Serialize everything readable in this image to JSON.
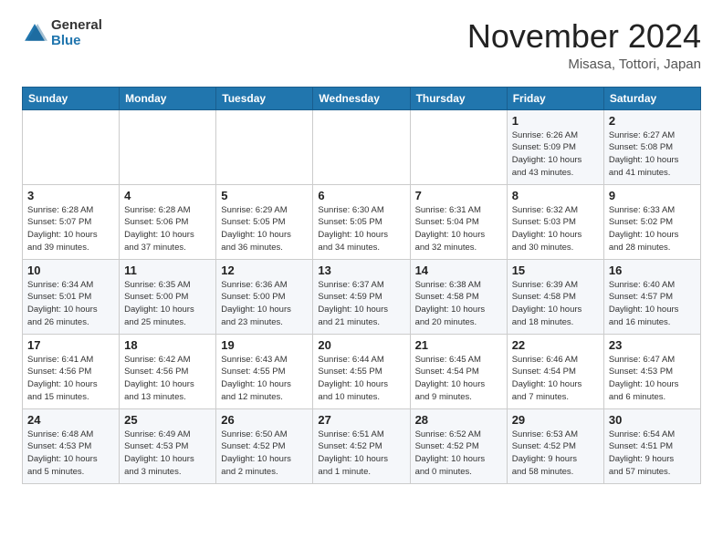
{
  "logo": {
    "general": "General",
    "blue": "Blue"
  },
  "title": "November 2024",
  "location": "Misasa, Tottori, Japan",
  "days_of_week": [
    "Sunday",
    "Monday",
    "Tuesday",
    "Wednesday",
    "Thursday",
    "Friday",
    "Saturday"
  ],
  "weeks": [
    [
      {
        "day": "",
        "detail": ""
      },
      {
        "day": "",
        "detail": ""
      },
      {
        "day": "",
        "detail": ""
      },
      {
        "day": "",
        "detail": ""
      },
      {
        "day": "",
        "detail": ""
      },
      {
        "day": "1",
        "detail": "Sunrise: 6:26 AM\nSunset: 5:09 PM\nDaylight: 10 hours\nand 43 minutes."
      },
      {
        "day": "2",
        "detail": "Sunrise: 6:27 AM\nSunset: 5:08 PM\nDaylight: 10 hours\nand 41 minutes."
      }
    ],
    [
      {
        "day": "3",
        "detail": "Sunrise: 6:28 AM\nSunset: 5:07 PM\nDaylight: 10 hours\nand 39 minutes."
      },
      {
        "day": "4",
        "detail": "Sunrise: 6:28 AM\nSunset: 5:06 PM\nDaylight: 10 hours\nand 37 minutes."
      },
      {
        "day": "5",
        "detail": "Sunrise: 6:29 AM\nSunset: 5:05 PM\nDaylight: 10 hours\nand 36 minutes."
      },
      {
        "day": "6",
        "detail": "Sunrise: 6:30 AM\nSunset: 5:05 PM\nDaylight: 10 hours\nand 34 minutes."
      },
      {
        "day": "7",
        "detail": "Sunrise: 6:31 AM\nSunset: 5:04 PM\nDaylight: 10 hours\nand 32 minutes."
      },
      {
        "day": "8",
        "detail": "Sunrise: 6:32 AM\nSunset: 5:03 PM\nDaylight: 10 hours\nand 30 minutes."
      },
      {
        "day": "9",
        "detail": "Sunrise: 6:33 AM\nSunset: 5:02 PM\nDaylight: 10 hours\nand 28 minutes."
      }
    ],
    [
      {
        "day": "10",
        "detail": "Sunrise: 6:34 AM\nSunset: 5:01 PM\nDaylight: 10 hours\nand 26 minutes."
      },
      {
        "day": "11",
        "detail": "Sunrise: 6:35 AM\nSunset: 5:00 PM\nDaylight: 10 hours\nand 25 minutes."
      },
      {
        "day": "12",
        "detail": "Sunrise: 6:36 AM\nSunset: 5:00 PM\nDaylight: 10 hours\nand 23 minutes."
      },
      {
        "day": "13",
        "detail": "Sunrise: 6:37 AM\nSunset: 4:59 PM\nDaylight: 10 hours\nand 21 minutes."
      },
      {
        "day": "14",
        "detail": "Sunrise: 6:38 AM\nSunset: 4:58 PM\nDaylight: 10 hours\nand 20 minutes."
      },
      {
        "day": "15",
        "detail": "Sunrise: 6:39 AM\nSunset: 4:58 PM\nDaylight: 10 hours\nand 18 minutes."
      },
      {
        "day": "16",
        "detail": "Sunrise: 6:40 AM\nSunset: 4:57 PM\nDaylight: 10 hours\nand 16 minutes."
      }
    ],
    [
      {
        "day": "17",
        "detail": "Sunrise: 6:41 AM\nSunset: 4:56 PM\nDaylight: 10 hours\nand 15 minutes."
      },
      {
        "day": "18",
        "detail": "Sunrise: 6:42 AM\nSunset: 4:56 PM\nDaylight: 10 hours\nand 13 minutes."
      },
      {
        "day": "19",
        "detail": "Sunrise: 6:43 AM\nSunset: 4:55 PM\nDaylight: 10 hours\nand 12 minutes."
      },
      {
        "day": "20",
        "detail": "Sunrise: 6:44 AM\nSunset: 4:55 PM\nDaylight: 10 hours\nand 10 minutes."
      },
      {
        "day": "21",
        "detail": "Sunrise: 6:45 AM\nSunset: 4:54 PM\nDaylight: 10 hours\nand 9 minutes."
      },
      {
        "day": "22",
        "detail": "Sunrise: 6:46 AM\nSunset: 4:54 PM\nDaylight: 10 hours\nand 7 minutes."
      },
      {
        "day": "23",
        "detail": "Sunrise: 6:47 AM\nSunset: 4:53 PM\nDaylight: 10 hours\nand 6 minutes."
      }
    ],
    [
      {
        "day": "24",
        "detail": "Sunrise: 6:48 AM\nSunset: 4:53 PM\nDaylight: 10 hours\nand 5 minutes."
      },
      {
        "day": "25",
        "detail": "Sunrise: 6:49 AM\nSunset: 4:53 PM\nDaylight: 10 hours\nand 3 minutes."
      },
      {
        "day": "26",
        "detail": "Sunrise: 6:50 AM\nSunset: 4:52 PM\nDaylight: 10 hours\nand 2 minutes."
      },
      {
        "day": "27",
        "detail": "Sunrise: 6:51 AM\nSunset: 4:52 PM\nDaylight: 10 hours\nand 1 minute."
      },
      {
        "day": "28",
        "detail": "Sunrise: 6:52 AM\nSunset: 4:52 PM\nDaylight: 10 hours\nand 0 minutes."
      },
      {
        "day": "29",
        "detail": "Sunrise: 6:53 AM\nSunset: 4:52 PM\nDaylight: 9 hours\nand 58 minutes."
      },
      {
        "day": "30",
        "detail": "Sunrise: 6:54 AM\nSunset: 4:51 PM\nDaylight: 9 hours\nand 57 minutes."
      }
    ]
  ]
}
